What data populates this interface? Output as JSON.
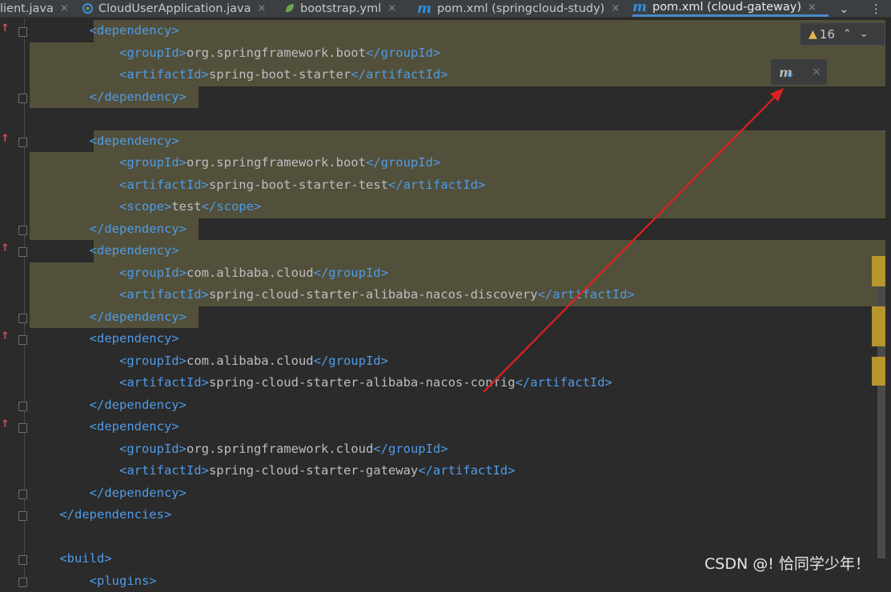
{
  "tabs": [
    {
      "label": "lient.java",
      "icon": "none",
      "close": "×",
      "active": false
    },
    {
      "label": "CloudUserApplication.java",
      "icon": "spring-boot-class-icon",
      "close": "×",
      "active": false
    },
    {
      "label": "bootstrap.yml",
      "icon": "spring-leaf-icon",
      "close": "×",
      "active": false
    },
    {
      "label": "pom.xml (springcloud-study)",
      "icon": "maven-m-icon",
      "icon_text": "m",
      "close": "×",
      "active": false
    },
    {
      "label": "pom.xml (cloud-gateway)",
      "icon": "maven-m-icon",
      "icon_text": "m",
      "close": "×",
      "active": true
    }
  ],
  "tab_actions": {
    "dropdown": "⌄",
    "more": "⋮"
  },
  "inspection": {
    "warning_icon": "▲",
    "count": "16",
    "up": "⌃",
    "down": "⌄"
  },
  "maven_popup": {
    "icon_text": "m",
    "sync_icon": "↻",
    "close": "×"
  },
  "code_lines": [
    {
      "indent": "        ",
      "open": "<dependency>",
      "text": "",
      "close": "",
      "highlight": "partial",
      "fold": true,
      "mark": true
    },
    {
      "indent": "            ",
      "open": "<groupId>",
      "text": "org.springframework.boot",
      "close": "</groupId>",
      "highlight": "full"
    },
    {
      "indent": "            ",
      "open": "<artifactId>",
      "text": "spring-boot-starter",
      "close": "</artifactId>",
      "highlight": "full"
    },
    {
      "indent": "        ",
      "open": "",
      "text": "",
      "close": "</dependency>",
      "highlight": "end",
      "fold": true
    },
    {
      "indent": "",
      "open": "",
      "text": "",
      "close": "",
      "highlight": "none"
    },
    {
      "indent": "        ",
      "open": "<dependency>",
      "text": "",
      "close": "",
      "highlight": "partial",
      "fold": true,
      "mark": true
    },
    {
      "indent": "            ",
      "open": "<groupId>",
      "text": "org.springframework.boot",
      "close": "</groupId>",
      "highlight": "full"
    },
    {
      "indent": "            ",
      "open": "<artifactId>",
      "text": "spring-boot-starter-test",
      "close": "</artifactId>",
      "highlight": "full"
    },
    {
      "indent": "            ",
      "open": "<scope>",
      "text": "test",
      "close": "</scope>",
      "highlight": "full"
    },
    {
      "indent": "        ",
      "open": "",
      "text": "",
      "close": "</dependency>",
      "highlight": "end",
      "fold": true
    },
    {
      "indent": "        ",
      "open": "<dependency>",
      "text": "",
      "close": "",
      "highlight": "partial",
      "fold": true,
      "mark": true
    },
    {
      "indent": "            ",
      "open": "<groupId>",
      "text": "com.alibaba.cloud",
      "close": "</groupId>",
      "highlight": "full"
    },
    {
      "indent": "            ",
      "open": "<artifactId>",
      "text": "spring-cloud-starter-alibaba-nacos-discovery",
      "close": "</artifactId>",
      "highlight": "full"
    },
    {
      "indent": "        ",
      "open": "",
      "text": "",
      "close": "</dependency>",
      "highlight": "end",
      "fold": true
    },
    {
      "indent": "        ",
      "open": "<dependency>",
      "text": "",
      "close": "",
      "highlight": "none",
      "fold": true,
      "mark": true
    },
    {
      "indent": "            ",
      "open": "<groupId>",
      "text": "com.alibaba.cloud",
      "close": "</groupId>",
      "highlight": "none"
    },
    {
      "indent": "            ",
      "open": "<artifactId>",
      "text": "spring-cloud-starter-alibaba-nacos-config",
      "close": "</artifactId>",
      "highlight": "none"
    },
    {
      "indent": "        ",
      "open": "",
      "text": "",
      "close": "</dependency>",
      "highlight": "none",
      "fold": true
    },
    {
      "indent": "        ",
      "open": "<dependency>",
      "text": "",
      "close": "",
      "highlight": "none",
      "fold": true,
      "mark": true
    },
    {
      "indent": "            ",
      "open": "<groupId>",
      "text": "org.springframework.cloud",
      "close": "</groupId>",
      "highlight": "none"
    },
    {
      "indent": "            ",
      "open": "<artifactId>",
      "text": "spring-cloud-starter-gateway",
      "close": "</artifactId>",
      "highlight": "none"
    },
    {
      "indent": "        ",
      "open": "",
      "text": "",
      "close": "</dependency>",
      "highlight": "none",
      "fold": true
    },
    {
      "indent": "    ",
      "open": "",
      "text": "",
      "close": "</dependencies>",
      "highlight": "none",
      "fold": true
    },
    {
      "indent": "",
      "open": "",
      "text": "",
      "close": "",
      "highlight": "none"
    },
    {
      "indent": "    ",
      "open": "<build>",
      "text": "",
      "close": "",
      "highlight": "none",
      "fold": true
    },
    {
      "indent": "        ",
      "open": "<plugins>",
      "text": "",
      "close": "",
      "highlight": "none",
      "fold": true
    }
  ],
  "change_marker": "↑",
  "colors": {
    "tag": "#4f9be8",
    "text": "#bcbec4",
    "highlight": "#52503a",
    "arrow": "#e02020",
    "scroll_mark": "#b8962e"
  },
  "watermark": "CSDN @! 恰同学少年！"
}
